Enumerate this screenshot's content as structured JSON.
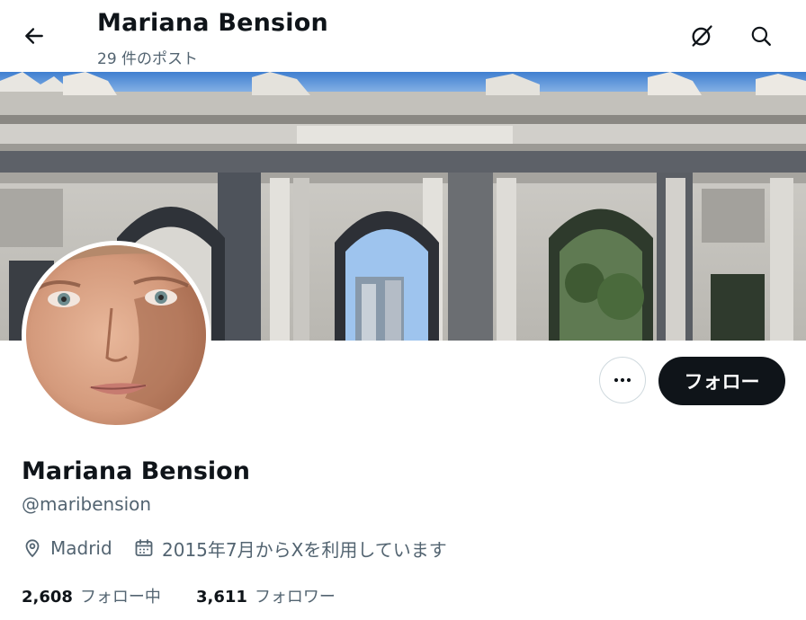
{
  "header": {
    "name": "Mariana Bension",
    "post_count": "29 件のポスト"
  },
  "profile": {
    "name": "Mariana Bension",
    "handle": "@maribension",
    "location": "Madrid",
    "joined": "2015年7月からXを利用しています",
    "follow_label": "フォロー",
    "stats": {
      "following_count": "2,608",
      "following_label": "フォロー中",
      "followers_count": "3,611",
      "followers_label": "フォロワー"
    }
  },
  "icons": {
    "back": "arrow-left-icon",
    "grok": "grok-icon",
    "search": "search-icon",
    "more": "more-dots-icon",
    "location": "location-pin-icon",
    "calendar": "calendar-icon"
  },
  "colors": {
    "text": "#0f1419",
    "secondary_text": "#536471",
    "follow_button_bg": "#0f1419",
    "border": "#cfd9de"
  }
}
